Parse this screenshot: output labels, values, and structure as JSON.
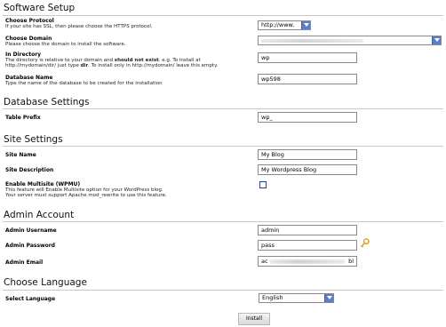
{
  "sections": {
    "software_setup": "Software Setup",
    "database_settings": "Database Settings",
    "site_settings": "Site Settings",
    "admin_account": "Admin Account",
    "choose_language": "Choose Language"
  },
  "protocol": {
    "label": "Choose Protocol",
    "desc": "If your site has SSL, then please choose the HTTPS protocol.",
    "value": "http://www."
  },
  "domain": {
    "label": "Choose Domain",
    "desc": "Please choose the domain to install the software."
  },
  "directory": {
    "label": "In Directory",
    "desc_line1_pre": "The directory is relative to your domain and ",
    "desc_line1_bold": "should not exist",
    "desc_line1_post": ". e.g. To install at",
    "desc_line2_pre": "http://mydomain/dir/ just type ",
    "desc_line2_bold": "dir",
    "desc_line2_post": ". To install only in http://mydomain/ leave this empty.",
    "value": "wp"
  },
  "database_name": {
    "label": "Database Name",
    "desc": "Type the name of the database to be created for the installation",
    "value": "wp598"
  },
  "table_prefix": {
    "label": "Table Prefix",
    "value": "wp_"
  },
  "site_name": {
    "label": "Site Name",
    "value": "My Blog"
  },
  "site_description": {
    "label": "Site Description",
    "value": "My Wordpress Blog"
  },
  "multisite": {
    "label": "Enable Multisite (WPMU)",
    "desc_line1": "This feature will Enable Multisite option for your WordPress blog.",
    "desc_line2": "Your server must support Apache mod_rewrite to use this feature.",
    "checked": false
  },
  "admin_username": {
    "label": "Admin Username",
    "value": "admin"
  },
  "admin_password": {
    "label": "Admin Password",
    "value": "pass"
  },
  "admin_email": {
    "label": "Admin Email",
    "value_start": "ac",
    "value_end": "bl"
  },
  "language": {
    "label": "Select Language",
    "value": "English"
  },
  "install_button": "Install",
  "colors": {
    "select_arrow": "#5b7fc8",
    "checkbox_border": "#1f3f8f",
    "key_icon": "#d9a21a"
  }
}
